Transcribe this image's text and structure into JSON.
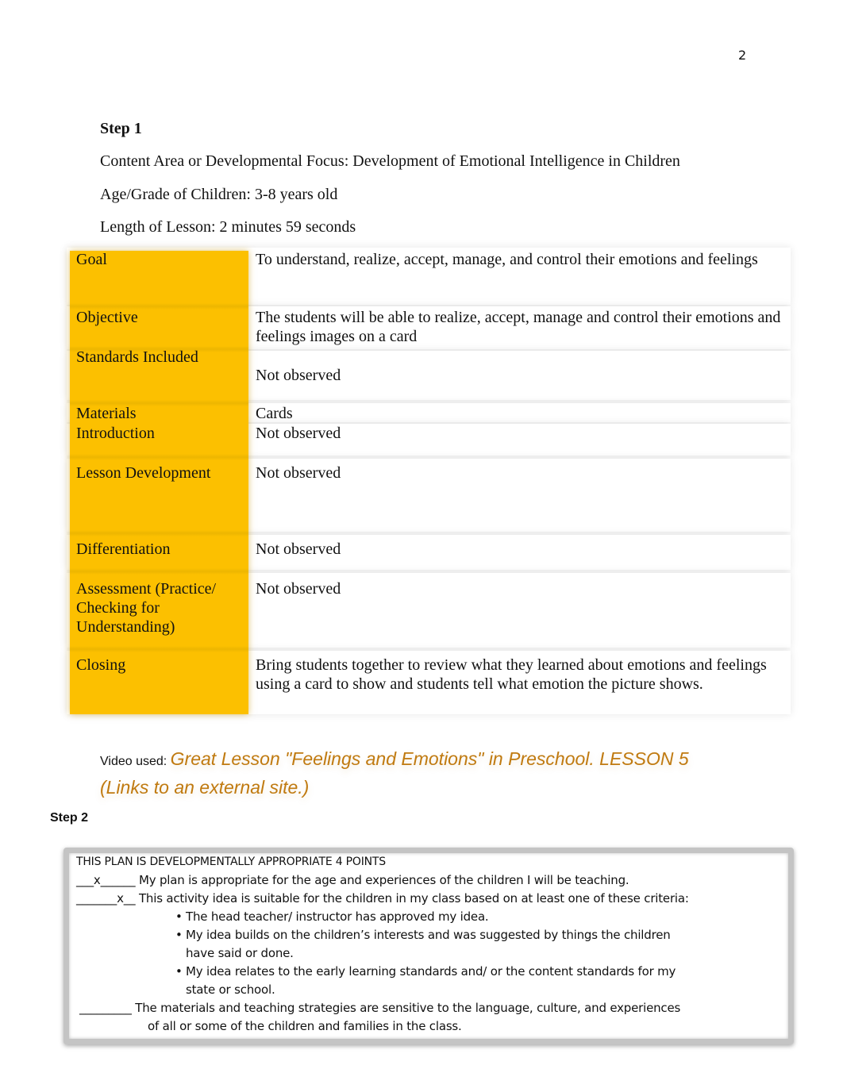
{
  "page_number": "2",
  "step1": {
    "title": "Step 1",
    "content_area": "Content Area or Developmental Focus: Development of Emotional Intelligence in Children",
    "age_grade": "Age/Grade of Children: 3-8 years old",
    "lesson_length": "Length of Lesson: 2 minutes 59 seconds"
  },
  "lesson_table": {
    "label_color": "#fcc000",
    "rows": [
      {
        "label": "Goal",
        "value": "To understand, realize, accept, manage, and control their emotions and feelings"
      },
      {
        "label": "Objective",
        "value": "The students will be able to realize, accept, manage and control their emotions and feelings images on a card"
      },
      {
        "label": "Standards Included",
        "value": "Not observed"
      },
      {
        "label": "Materials",
        "value": "Cards"
      },
      {
        "label": "Introduction",
        "value": "Not observed"
      },
      {
        "label": "Lesson Development",
        "value": "Not observed"
      },
      {
        "label": "Differentiation",
        "value": "Not observed"
      },
      {
        "label": "Assessment (Practice/ Checking for Understanding)",
        "value": "Not observed"
      },
      {
        "label": "Closing",
        "value": "Bring students together to review what they learned about emotions and feelings using a card to show and students tell what emotion the picture shows."
      }
    ]
  },
  "video": {
    "prefix": "Video used: ",
    "link_text": "Great Lesson \"Feelings and Emotions\" in Preschool. LESSON 5 (Links to an external site.)",
    "link_color": "#c07a10"
  },
  "step2": {
    "title": "Step 2",
    "heading": "THIS PLAN IS DEVELOPMENTALLY APPROPRIATE 4 POINTS",
    "items": [
      {
        "mark": "___x______",
        "text": " My plan is appropriate for the age and experiences of the children I will be teaching."
      },
      {
        "mark": "_______x__",
        "text": " This activity idea is suitable for the children in my class based on at least one of these criteria:"
      },
      {
        "mark": "_________",
        "text": " The materials and teaching strategies are sensitive to the language, culture, and experiences",
        "continuation": "of all or some of the children and families in the class."
      }
    ],
    "bullets": [
      {
        "line1": "The head teacher/ instructor has approved my idea.",
        "line2": ""
      },
      {
        "line1": "My idea builds on the children’s interests and was suggested by things the children",
        "line2": "have said or done."
      },
      {
        "line1": "My idea relates to the early learning standards and/ or the content standards for my",
        "line2": "state or school."
      }
    ]
  }
}
